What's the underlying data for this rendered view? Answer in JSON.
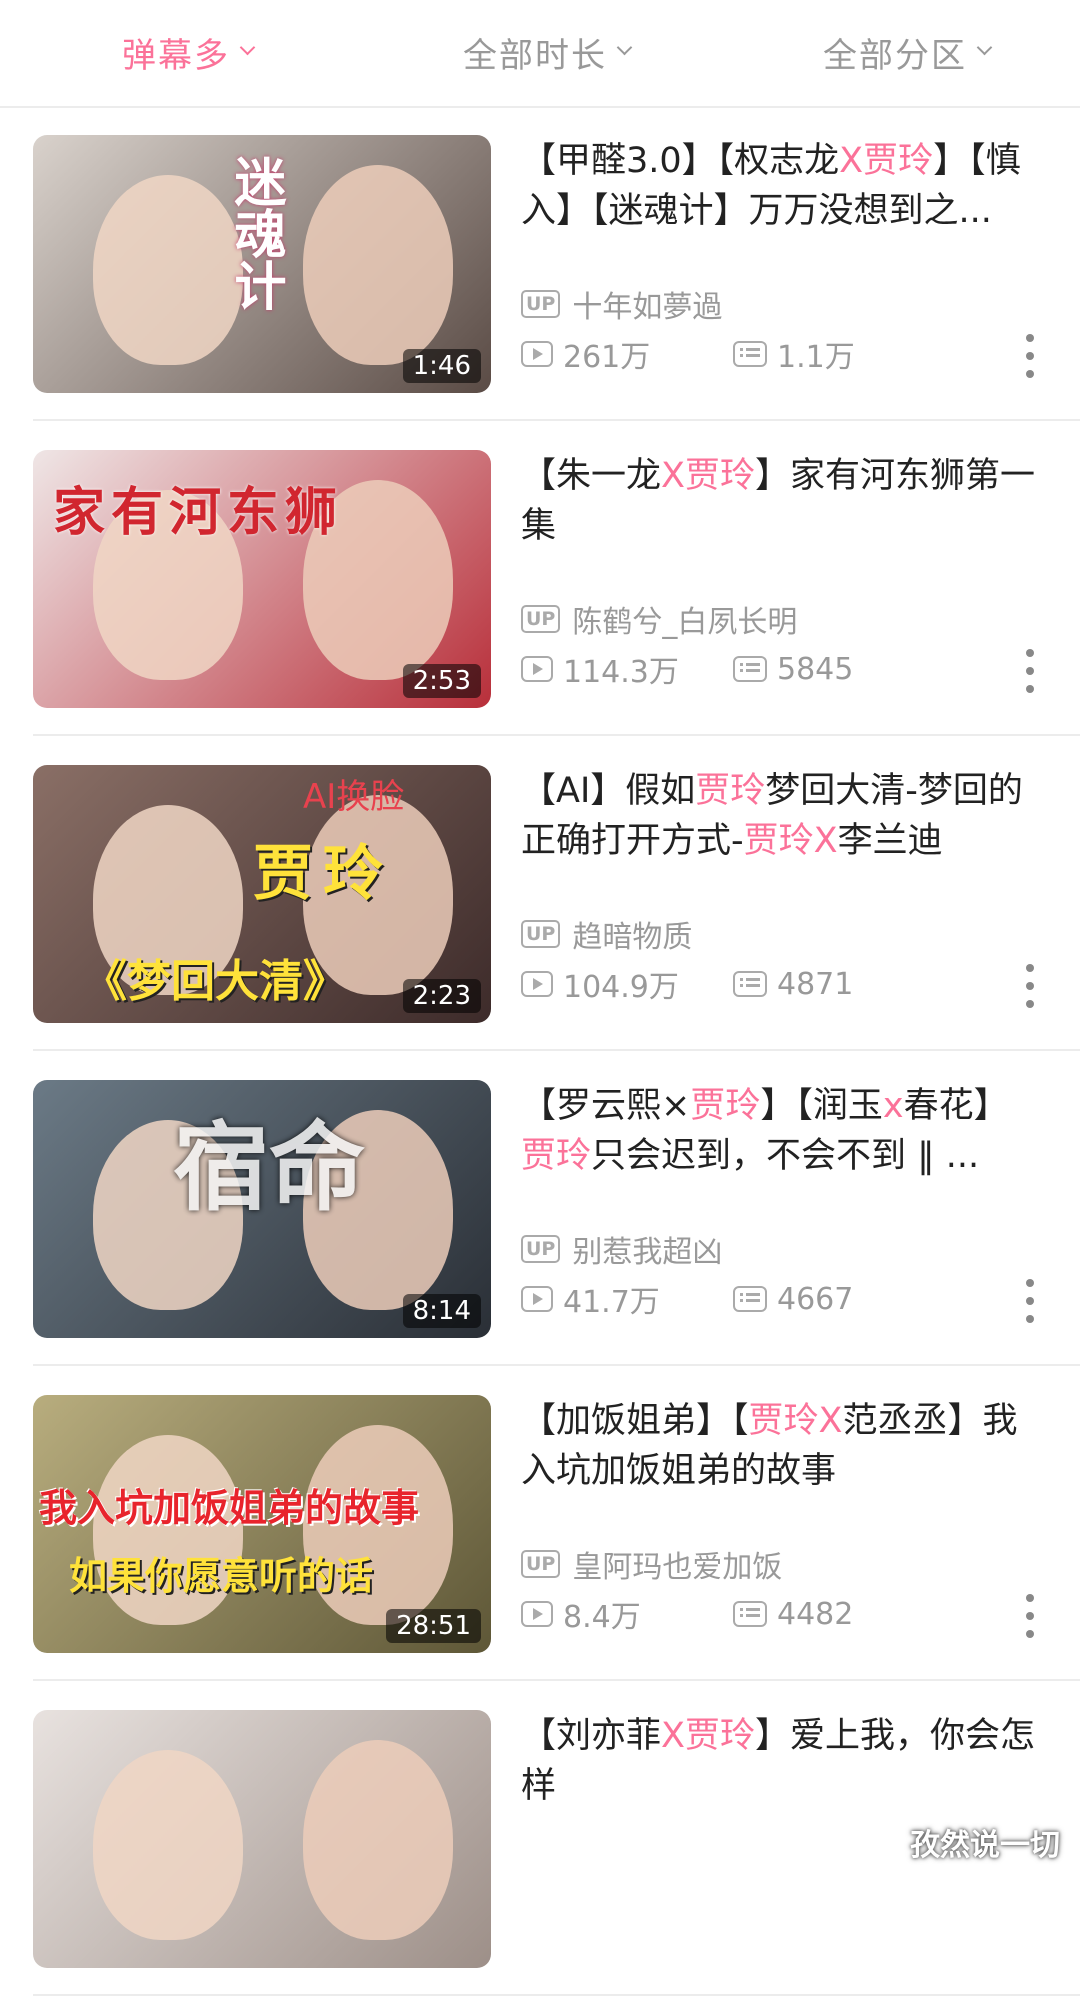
{
  "filters": [
    {
      "label": "弹幕多",
      "active": true
    },
    {
      "label": "全部时长",
      "active": false
    },
    {
      "label": "全部分区",
      "active": false
    }
  ],
  "accent_color": "#fb7299",
  "videos": [
    {
      "title_parts": [
        [
          "【甲醛3.0】【权志龙",
          0
        ],
        [
          "X贾玲",
          1
        ],
        [
          "】【慎入】【迷魂计】万万没想到之...",
          0
        ]
      ],
      "uploader": "十年如夢過",
      "views": "261万",
      "danmaku": "1.1万",
      "duration": "1:46",
      "thumb_text": "迷魂计",
      "thumb_colors": [
        "#d9d2cc",
        "#5a4b45"
      ]
    },
    {
      "title_parts": [
        [
          "【朱一龙",
          0
        ],
        [
          "X贾玲",
          1
        ],
        [
          "】家有河东狮第一集",
          0
        ]
      ],
      "uploader": "陈鹤兮_白夙长明",
      "views": "114.3万",
      "danmaku": "5845",
      "duration": "2:53",
      "thumb_text": "家有河东狮",
      "thumb_colors": [
        "#efe6e6",
        "#b82f3a"
      ]
    },
    {
      "title_parts": [
        [
          "【AI】假如",
          0
        ],
        [
          "贾玲",
          1
        ],
        [
          "梦回大清-梦回的正确打开方式-",
          0
        ],
        [
          "贾玲X",
          1
        ],
        [
          "李兰迪",
          0
        ]
      ],
      "uploader": "趋暗物质",
      "views": "104.9万",
      "danmaku": "4871",
      "duration": "2:23",
      "thumb_text": "贾玲",
      "thumb_subtext": "《梦回大清》",
      "thumb_corner": "AI换脸",
      "thumb_colors": [
        "#8a6f66",
        "#3d2b2a"
      ]
    },
    {
      "title_parts": [
        [
          "【罗云熙×",
          0
        ],
        [
          "贾玲",
          1
        ],
        [
          "】【润玉",
          0
        ],
        [
          "x",
          1
        ],
        [
          "春花】",
          0
        ],
        [
          "贾玲",
          1
        ],
        [
          "只会迟到，不会不到 ‖ ...",
          0
        ]
      ],
      "uploader": "别惹我超凶",
      "views": "41.7万",
      "danmaku": "4667",
      "duration": "8:14",
      "thumb_text": "宿命",
      "thumb_colors": [
        "#6b7a86",
        "#2a2f36"
      ]
    },
    {
      "title_parts": [
        [
          "【加饭姐弟】【",
          0
        ],
        [
          "贾玲X",
          1
        ],
        [
          "范丞丞】我入坑加饭姐弟的故事",
          0
        ]
      ],
      "uploader": "皇阿玛也爱加饭",
      "views": "8.4万",
      "danmaku": "4482",
      "duration": "28:51",
      "thumb_text": "我入坑加饭姐弟的故事",
      "thumb_subtext": "如果你愿意听的话",
      "thumb_colors": [
        "#b8ad7e",
        "#5e5737"
      ]
    },
    {
      "title_parts": [
        [
          "【刘亦菲",
          0
        ],
        [
          "X贾玲",
          1
        ],
        [
          "】爱上我，你会怎样",
          0
        ]
      ],
      "uploader": "",
      "views": "",
      "danmaku": "",
      "duration": "",
      "thumb_text": "",
      "thumb_colors": [
        "#e8e2df",
        "#9d8f88"
      ]
    }
  ],
  "watermark": "孜然说一切"
}
